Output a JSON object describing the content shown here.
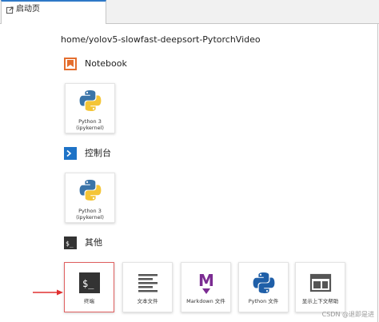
{
  "tab": {
    "label": "启动页",
    "icon": "launcher-icon"
  },
  "path": "home/yolov5-slowfast-deepsort-PytorchVideo",
  "sections": {
    "notebook": {
      "title": "Notebook",
      "icon": "notebook-icon",
      "accent": "#e46e2e"
    },
    "console": {
      "title": "控制台",
      "icon": "console-icon",
      "accent": "#1e73c7"
    },
    "other": {
      "title": "其他",
      "icon": "terminal-icon"
    }
  },
  "notebook_kernels": [
    {
      "line1": "Python 3",
      "line2": "(ipykernel)"
    }
  ],
  "console_kernels": [
    {
      "line1": "Python 3",
      "line2": "(ipykernel)"
    }
  ],
  "other_items": [
    {
      "label": "终端",
      "icon": "terminal-icon"
    },
    {
      "label": "文本文件",
      "icon": "text-file-icon"
    },
    {
      "label": "Markdown 文件",
      "icon": "markdown-icon"
    },
    {
      "label": "Python 文件",
      "icon": "python-file-icon"
    },
    {
      "label": "显示上下文帮助",
      "icon": "context-help-icon"
    }
  ],
  "colors": {
    "selection_border": "#e06060",
    "arrow": "#e03030",
    "markdown": "#7b2c92"
  },
  "watermark": "CSDN @退即是进"
}
